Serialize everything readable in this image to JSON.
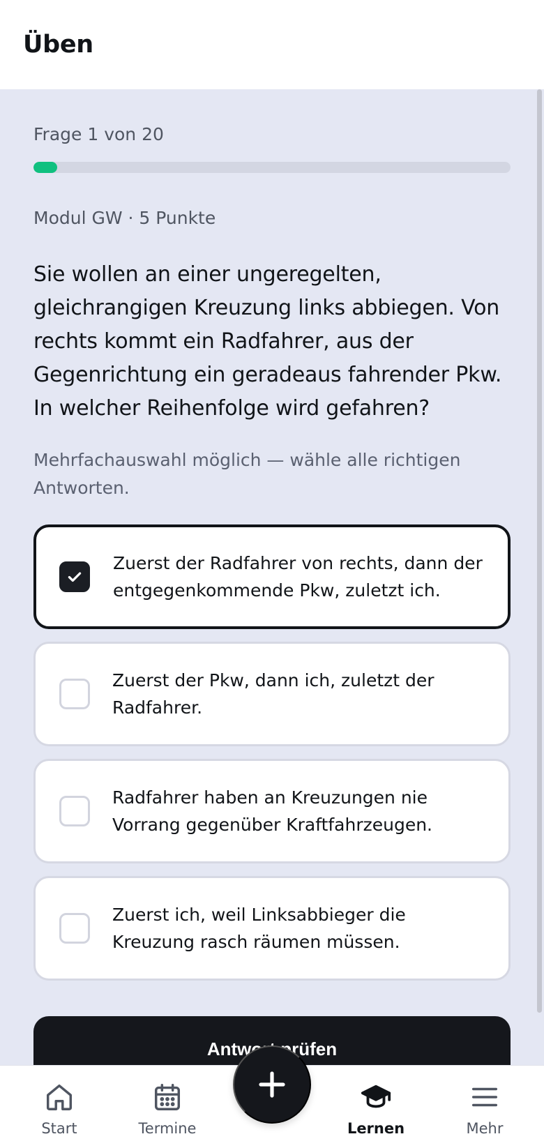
{
  "header": {
    "title": "Üben"
  },
  "quiz": {
    "counter": "Frage 1 von 20",
    "progress_fraction": 0.05,
    "meta": "Modul GW · 5 Punkte",
    "question": "Sie wollen an einer ungeregelten, gleichrangigen Kreuzung links abbiegen. Von rechts kommt ein Radfahrer, aus der Gegenrichtung ein geradeaus fahrender Pkw. In welcher Reihenfolge wird gefahren?",
    "hint": "Mehrfachauswahl möglich — wähle alle richtigen Antworten.",
    "answers": [
      {
        "label": "Zuerst der Radfahrer von rechts, dann der entgegenkommende Pkw, zuletzt ich.",
        "selected": true
      },
      {
        "label": "Zuerst der Pkw, dann ich, zuletzt der Radfahrer.",
        "selected": false
      },
      {
        "label": "Radfahrer haben an Kreuzungen nie Vorrang gegenüber Kraftfahrzeugen.",
        "selected": false
      },
      {
        "label": "Zuerst ich, weil Linksabbieger die Kreuzung rasch räumen müssen.",
        "selected": false
      }
    ],
    "submit_label": "Antwort prüfen"
  },
  "nav": {
    "items": [
      {
        "label": "Start",
        "icon": "home-icon"
      },
      {
        "label": "Termine",
        "icon": "calendar-icon"
      },
      {
        "label": "Lernen",
        "icon": "graduation-cap-icon",
        "active": true
      },
      {
        "label": "Mehr",
        "icon": "menu-icon"
      }
    ],
    "fab_icon": "plus-icon"
  },
  "colors": {
    "accent_progress": "#10c07f",
    "background": "#e4e7f3",
    "dark": "#15171c"
  }
}
